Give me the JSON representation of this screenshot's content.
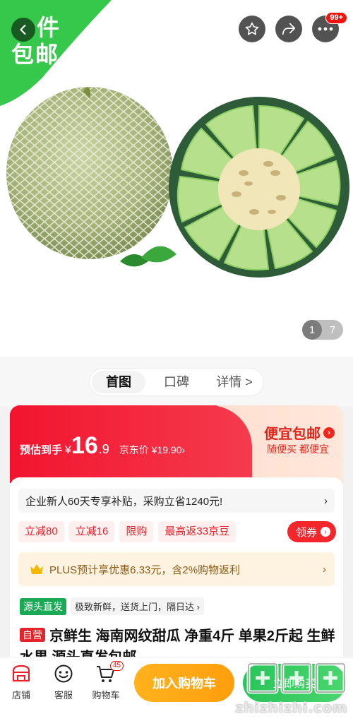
{
  "promo": {
    "line1": "件",
    "line2": "包邮"
  },
  "header": {
    "more_badge": "99+"
  },
  "gallery": {
    "current": "1",
    "total": "7"
  },
  "tabs": [
    {
      "label": "首图",
      "active": true
    },
    {
      "label": "口碑",
      "active": false
    },
    {
      "label": "详情 >",
      "active": false
    }
  ],
  "price": {
    "label": "预估到手",
    "currency": "¥",
    "integer": "16",
    "decimal": ".9",
    "jd_price": "京东价 ¥19.90›"
  },
  "cheap_shipping": {
    "title": "便宜包邮",
    "subtitle": "随便买 都便宜"
  },
  "subsidy": {
    "text": "企业新人60天专享补贴，采购立省1240元!",
    "arrow": "›"
  },
  "coupons": [
    "立减80",
    "立减16",
    "限购",
    "最高返33京豆"
  ],
  "get_coupon": {
    "label": "领券"
  },
  "plus": {
    "text": "PLUS预计享优惠6.33元，含2%购物返利",
    "arrow": "›"
  },
  "source": {
    "badge": "源头直发",
    "text": "极致新鲜，送货上门，隔日达 ›"
  },
  "product": {
    "self_badge": "自营",
    "title": "京鲜生 海南网纹甜瓜 净重4斤 单果2斤起 生鲜水果 源头直发包邮 ⌄"
  },
  "bottom_nav": [
    {
      "label": "店铺",
      "icon": "store-icon"
    },
    {
      "label": "客服",
      "icon": "service-icon"
    },
    {
      "label": "购物车",
      "icon": "cart-icon",
      "badge": "45"
    }
  ],
  "actions": {
    "add_to_cart": "加入购物车",
    "buy_now": "立即购买"
  },
  "watermark": {
    "text": "zhizhizhi.com"
  },
  "colors": {
    "jd_red": "#f2142f",
    "orange": "#ffa514",
    "green": "#27c55a",
    "promo_green": "#35c84a"
  }
}
